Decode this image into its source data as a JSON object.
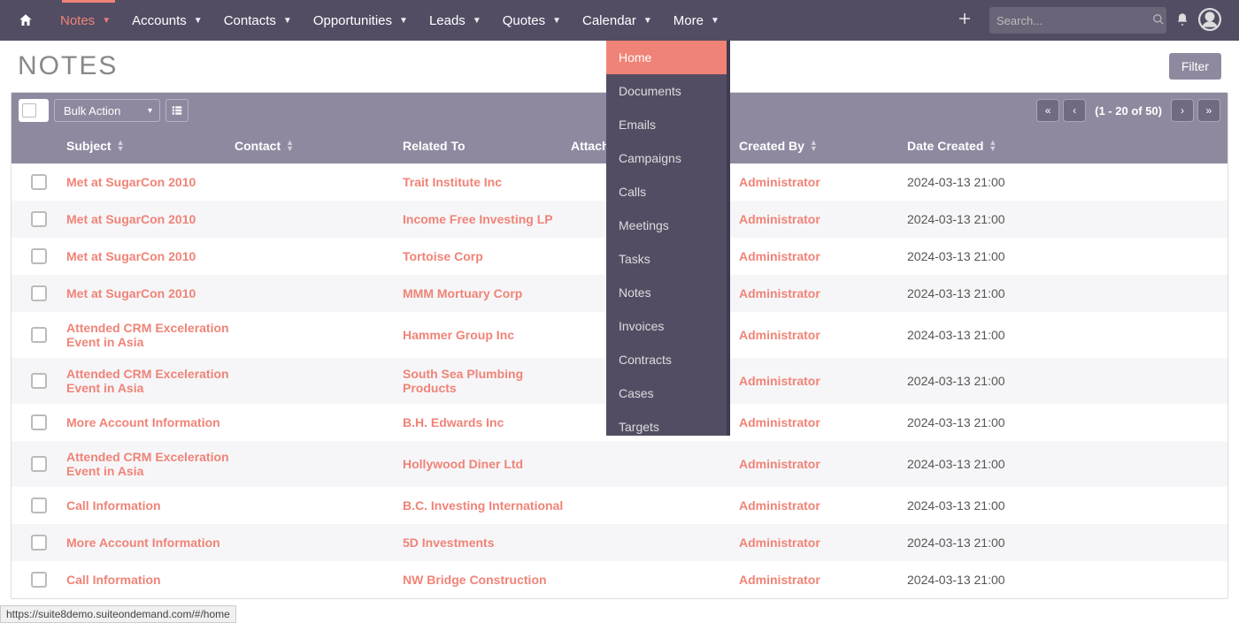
{
  "nav": {
    "items": [
      {
        "label": "Notes",
        "active": true
      },
      {
        "label": "Accounts"
      },
      {
        "label": "Contacts"
      },
      {
        "label": "Opportunities"
      },
      {
        "label": "Leads"
      },
      {
        "label": "Quotes"
      },
      {
        "label": "Calendar"
      },
      {
        "label": "More"
      }
    ],
    "search_placeholder": "Search..."
  },
  "page": {
    "title": "NOTES",
    "filter_label": "Filter"
  },
  "toolbar": {
    "bulk_action_label": "Bulk Action",
    "pager_info": "(1 - 20 of 50)"
  },
  "columns": {
    "subject": "Subject",
    "contact": "Contact",
    "related_to": "Related To",
    "attachment": "Attachm",
    "created_by": "Created By",
    "date_created": "Date Created"
  },
  "rows": [
    {
      "subject": "Met at SugarCon 2010",
      "related_to": "Trait Institute Inc",
      "created_by": "Administrator",
      "date_created": "2024-03-13 21:00"
    },
    {
      "subject": "Met at SugarCon 2010",
      "related_to": "Income Free Investing LP",
      "created_by": "Administrator",
      "date_created": "2024-03-13 21:00"
    },
    {
      "subject": "Met at SugarCon 2010",
      "related_to": "Tortoise Corp",
      "created_by": "Administrator",
      "date_created": "2024-03-13 21:00"
    },
    {
      "subject": "Met at SugarCon 2010",
      "related_to": "MMM Mortuary Corp",
      "created_by": "Administrator",
      "date_created": "2024-03-13 21:00"
    },
    {
      "subject": "Attended CRM Exceleration Event in Asia",
      "related_to": "Hammer Group Inc",
      "created_by": "Administrator",
      "date_created": "2024-03-13 21:00"
    },
    {
      "subject": "Attended CRM Exceleration Event in Asia",
      "related_to": "South Sea Plumbing Products",
      "created_by": "Administrator",
      "date_created": "2024-03-13 21:00"
    },
    {
      "subject": "More Account Information",
      "related_to": "B.H. Edwards Inc",
      "created_by": "Administrator",
      "date_created": "2024-03-13 21:00"
    },
    {
      "subject": "Attended CRM Exceleration Event in Asia",
      "related_to": "Hollywood Diner Ltd",
      "created_by": "Administrator",
      "date_created": "2024-03-13 21:00"
    },
    {
      "subject": "Call Information",
      "related_to": "B.C. Investing International",
      "created_by": "Administrator",
      "date_created": "2024-03-13 21:00"
    },
    {
      "subject": "More Account Information",
      "related_to": "5D Investments",
      "created_by": "Administrator",
      "date_created": "2024-03-13 21:00"
    },
    {
      "subject": "Call Information",
      "related_to": "NW Bridge Construction",
      "created_by": "Administrator",
      "date_created": "2024-03-13 21:00"
    }
  ],
  "dropdown": {
    "items": [
      {
        "label": "Home",
        "active": true
      },
      {
        "label": "Documents"
      },
      {
        "label": "Emails"
      },
      {
        "label": "Campaigns"
      },
      {
        "label": "Calls"
      },
      {
        "label": "Meetings"
      },
      {
        "label": "Tasks"
      },
      {
        "label": "Notes"
      },
      {
        "label": "Invoices"
      },
      {
        "label": "Contracts"
      },
      {
        "label": "Cases"
      },
      {
        "label": "Targets"
      }
    ]
  },
  "status_url": "https://suite8demo.suiteondemand.com/#/home"
}
